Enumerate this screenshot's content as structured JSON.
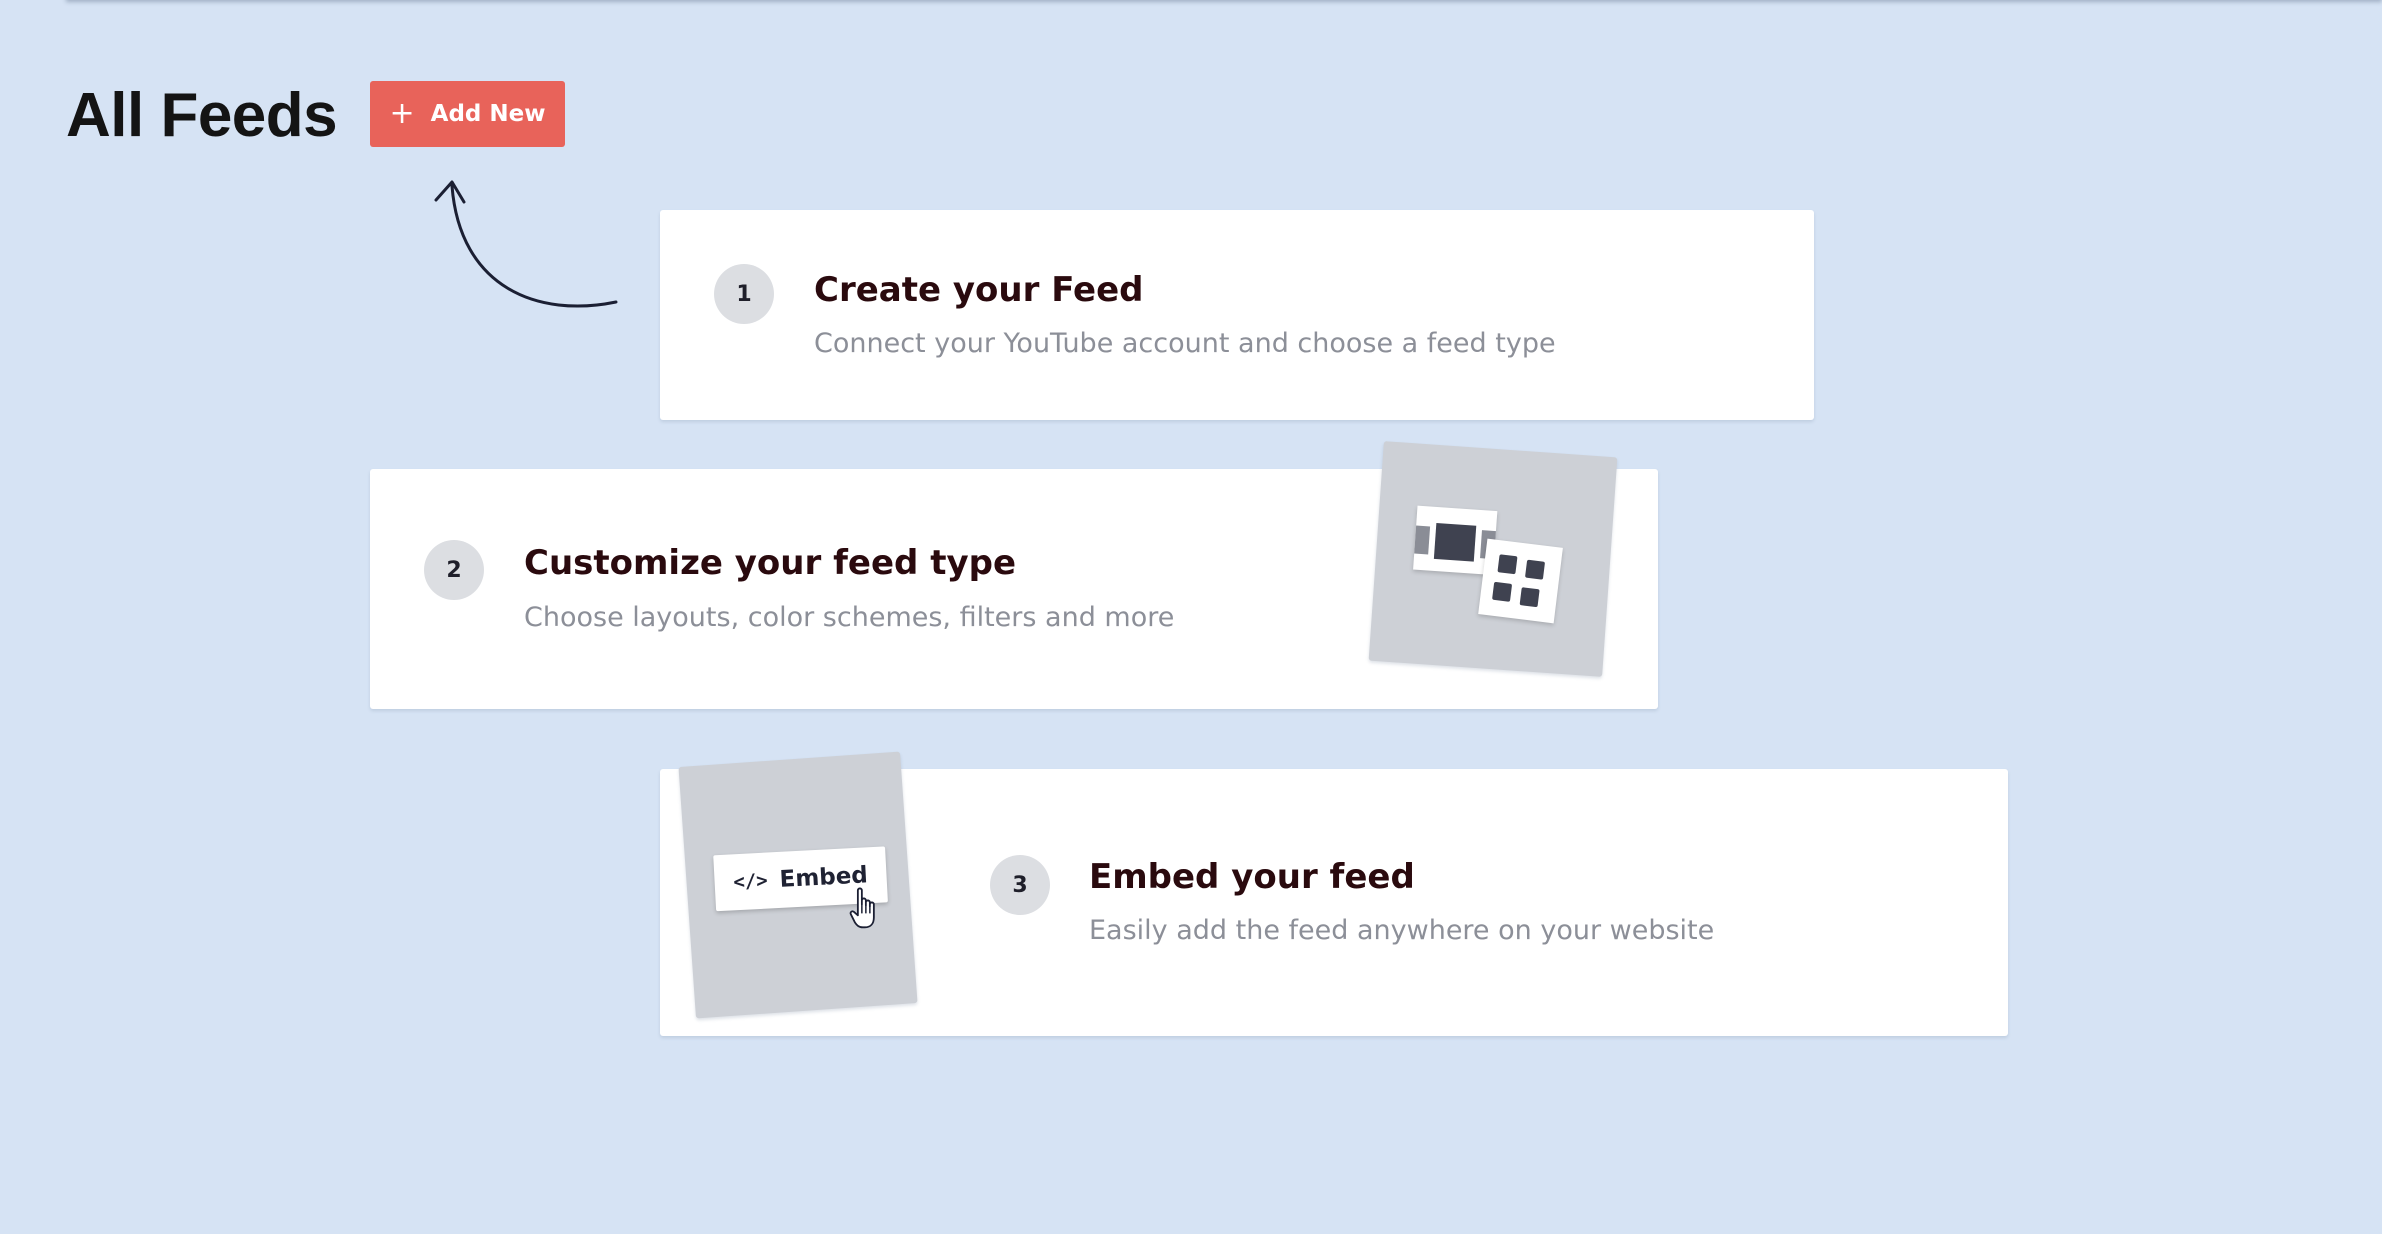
{
  "header": {
    "title": "All Feeds",
    "add_button": {
      "plus": "+",
      "label": "Add New",
      "color": "#e8635a"
    }
  },
  "steps": [
    {
      "number": "1",
      "title": "Create your Feed",
      "description": "Connect your YouTube account and choose a feed type"
    },
    {
      "number": "2",
      "title": "Customize your feed type",
      "description": "Choose layouts, color schemes, filters and more"
    },
    {
      "number": "3",
      "title": "Embed your feed",
      "description": "Easily add the feed anywhere on your website",
      "illustration": {
        "code_icon": "</>",
        "button_label": "Embed"
      }
    }
  ],
  "colors": {
    "background": "#d6e3f4",
    "card": "#ffffff",
    "title_text": "#2a0a0e",
    "description_text": "#8c8f98",
    "step_badge": "#dcdee2"
  }
}
